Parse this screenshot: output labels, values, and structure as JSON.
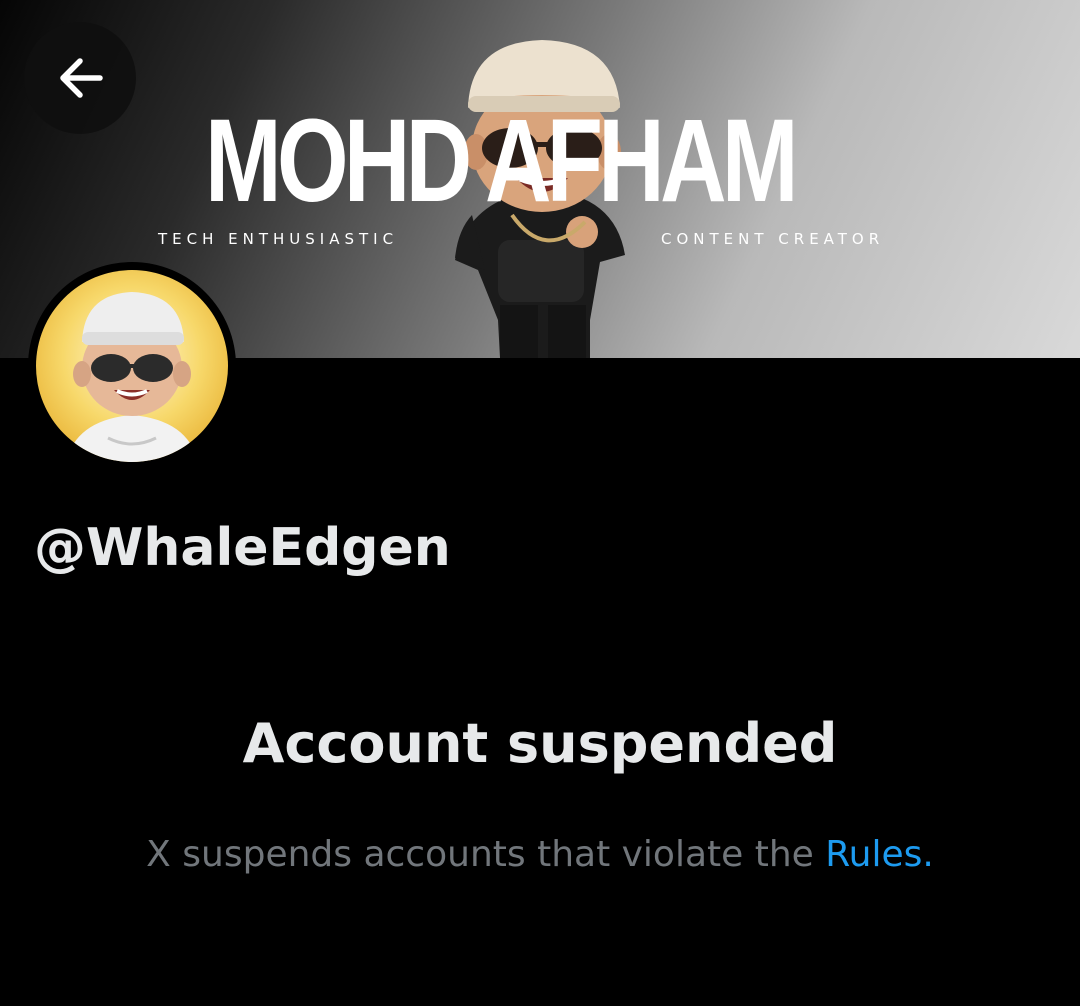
{
  "banner": {
    "name_text": "MOHD AFHAM",
    "tag_left": "TECH ENTHUSIASTIC",
    "tag_right": "CONTENT CREATOR"
  },
  "header": {
    "back_icon": "arrow-left-icon"
  },
  "profile": {
    "avatar_icon": "avatar-character",
    "handle": "@WhaleEdgen"
  },
  "notice": {
    "title": "Account suspended",
    "body_prefix": "X suspends accounts that violate the ",
    "rules_link": "Rules",
    "body_suffix": "."
  },
  "colors": {
    "background": "#000000",
    "primary_text": "#e7e9ea",
    "secondary_text": "#71767b",
    "link": "#1d9bf0"
  }
}
